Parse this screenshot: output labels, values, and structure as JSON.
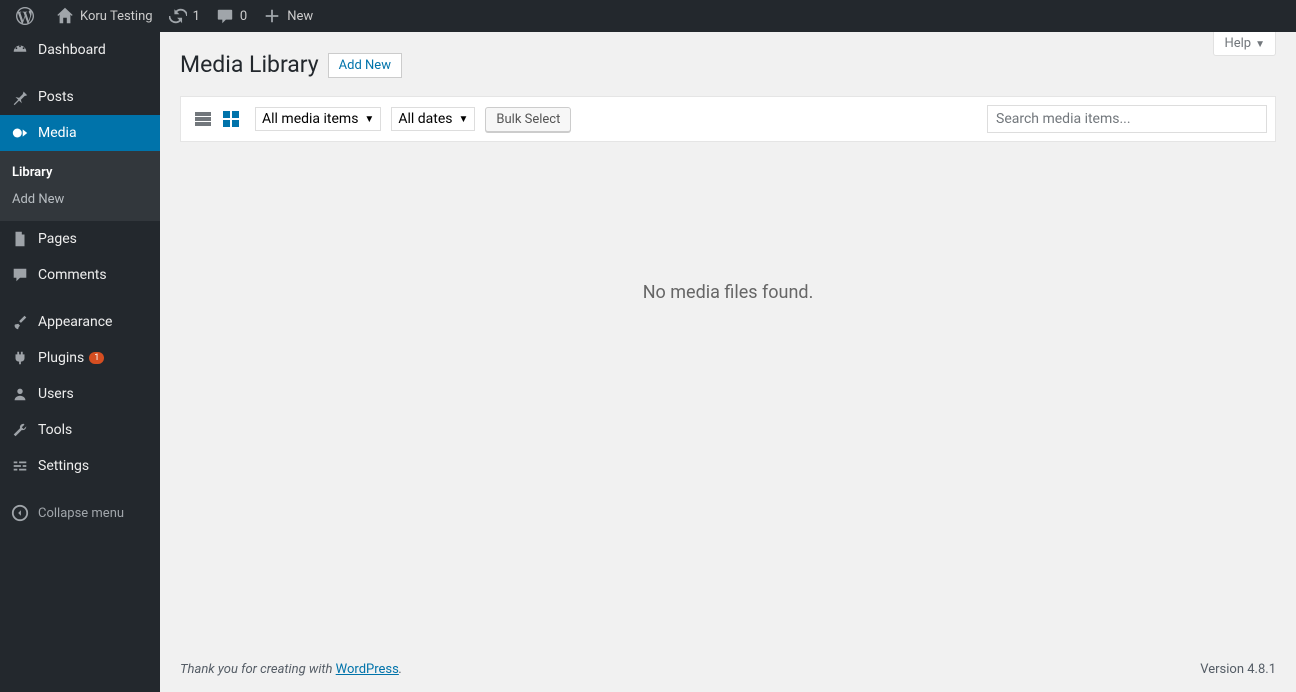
{
  "adminbar": {
    "site_name": "Koru Testing",
    "updates_count": "1",
    "comments_count": "0",
    "new_label": "New"
  },
  "sidebar": {
    "items": [
      {
        "label": "Dashboard"
      },
      {
        "label": "Posts"
      },
      {
        "label": "Media"
      },
      {
        "label": "Pages"
      },
      {
        "label": "Comments"
      },
      {
        "label": "Appearance"
      },
      {
        "label": "Plugins",
        "badge": "1"
      },
      {
        "label": "Users"
      },
      {
        "label": "Tools"
      },
      {
        "label": "Settings"
      }
    ],
    "submenu": [
      {
        "label": "Library"
      },
      {
        "label": "Add New"
      }
    ],
    "collapse_label": "Collapse menu"
  },
  "page": {
    "title": "Media Library",
    "add_new": "Add New",
    "help_label": "Help"
  },
  "toolbar": {
    "filter_type": "All media items",
    "filter_date": "All dates",
    "bulk_select": "Bulk Select",
    "search_placeholder": "Search media items..."
  },
  "empty_message": "No media files found.",
  "footer": {
    "thanks_prefix": "Thank you for creating with ",
    "wp_link": "WordPress",
    "version_label": "Version 4.8.1"
  }
}
